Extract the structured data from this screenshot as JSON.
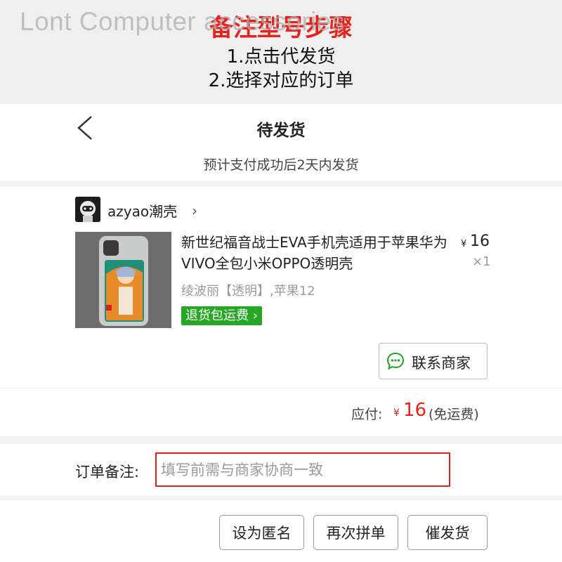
{
  "banner": {
    "watermark": "Lont Computer accessories",
    "title": "备注型号步骤",
    "steps": [
      "1.点击代发货",
      "2.选择对应的订单"
    ]
  },
  "header": {
    "title": "待发货",
    "subtitle": "预计支付成功后2天内发货"
  },
  "order": {
    "shop_name": "azyao潮壳",
    "product_title": "新世纪福音战士EVA手机壳适用于苹果华为VIVO全包小米OPPO透明壳",
    "price_symbol": "¥",
    "price": "16",
    "quantity": "×1",
    "spec": "绫波丽【透明】,苹果12",
    "return_badge": "退货包运费",
    "contact_button": "联系商家"
  },
  "payment": {
    "label": "应付:",
    "symbol": "¥",
    "amount": "16",
    "note": "(免运费)"
  },
  "remark": {
    "label": "订单备注:",
    "placeholder": "填写前需与商家协商一致",
    "border_color": "#e02020"
  },
  "actions": {
    "anonymous": "设为匿名",
    "regroup": "再次拼单",
    "urge": "催发货"
  },
  "colors": {
    "accent_red": "#e8221a",
    "badge_green": "#26a826"
  }
}
